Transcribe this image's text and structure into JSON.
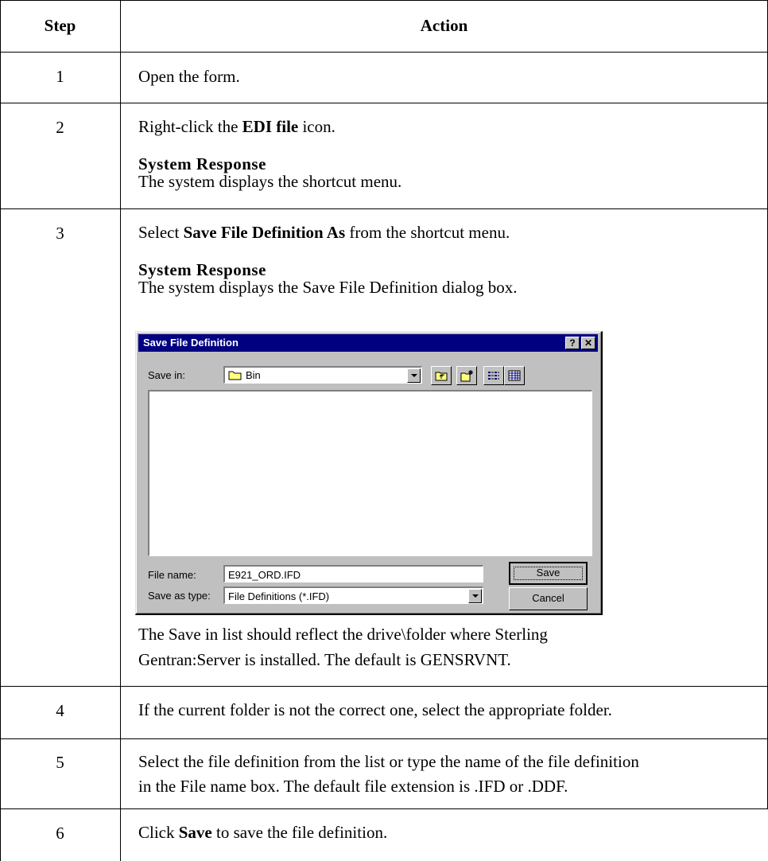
{
  "table": {
    "header": {
      "step": "Step",
      "action": "Action"
    },
    "rows": [
      {
        "step": "1",
        "text": "Open the form."
      },
      {
        "step": "2",
        "text_pre": "Right-click the ",
        "text_bold": "EDI file",
        "text_post": " icon.",
        "response_heading": "System Response",
        "response_text": "The system displays the shortcut menu."
      },
      {
        "step": "3",
        "text_pre": "Select ",
        "text_bold": "Save File Definition As",
        "text_post": " from the shortcut menu.",
        "response_heading": "System Response",
        "response_text": "The system displays the Save File Definition dialog box.",
        "note_line1": "The Save in list should reflect the drive\\folder where Sterling",
        "note_line2": "Gentran:Server is installed. The default is GENSRVNT."
      },
      {
        "step": "4",
        "text": "If the current folder is not the correct one, select the appropriate folder."
      },
      {
        "step": "5",
        "line1": "Select the file definition from the list or type the name of the file definition",
        "line2": "in the File name box. The default file extension is .IFD or .DDF."
      },
      {
        "step": "6",
        "text_pre": "Click ",
        "text_bold": "Save",
        "text_post": " to save the file definition."
      }
    ]
  },
  "dialog": {
    "title": "Save File Definition",
    "help_glyph": "?",
    "close_glyph": "✕",
    "save_in_label": "Save in:",
    "save_in_value": "Bin",
    "file_name_label": "File name:",
    "file_name_value": "E921_ORD.IFD",
    "save_as_type_label": "Save as type:",
    "save_as_type_value": "File Definitions (*.IFD)",
    "save_button": "Save",
    "cancel_button": "Cancel",
    "icons": [
      "folder-icon",
      "up-one-level-icon",
      "new-folder-icon",
      "list-view-icon",
      "details-view-icon"
    ]
  }
}
